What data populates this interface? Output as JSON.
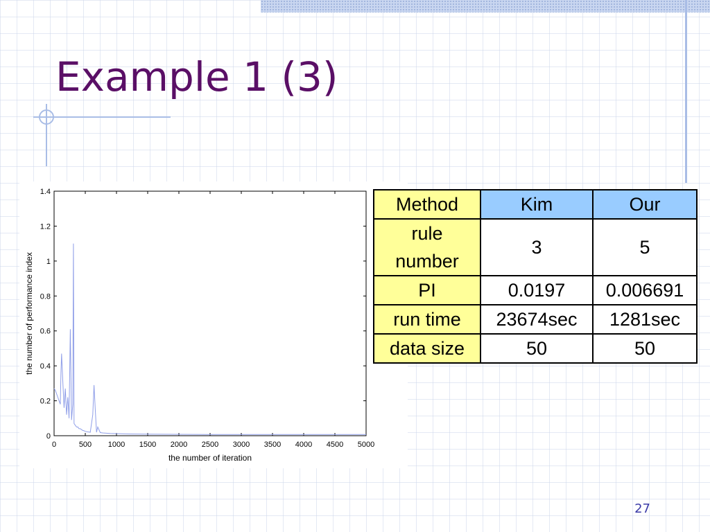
{
  "slide": {
    "title": "Example 1 (3)",
    "page_number": "27",
    "accent_color": "#5a0f66",
    "grid_color": "#cdd7eb"
  },
  "chart_data": {
    "type": "line",
    "title": "",
    "xlabel": "the number of iteration",
    "ylabel": "the number of performance index",
    "xlim": [
      0,
      5000
    ],
    "ylim": [
      0,
      1.4
    ],
    "xticks": [
      0,
      500,
      1000,
      1500,
      2000,
      2500,
      3000,
      3500,
      4000,
      4500,
      5000
    ],
    "yticks": [
      0,
      0.2,
      0.4,
      0.6,
      0.8,
      1,
      1.2,
      1.4
    ],
    "grid": false,
    "line_color": "#8f9ee8",
    "series": [
      {
        "x": [
          0,
          20,
          40,
          60,
          80,
          100,
          110,
          120,
          140,
          160,
          180,
          200,
          220,
          240,
          260,
          280,
          300,
          310,
          320,
          340,
          360,
          380,
          400,
          420,
          440,
          460,
          480,
          500,
          540,
          580,
          620,
          640,
          660,
          680,
          700,
          740,
          780,
          820,
          900,
          1000,
          1200,
          1500,
          2000,
          2500,
          3000,
          3500,
          4000,
          4500,
          5000
        ],
        "y": [
          0.27,
          0.26,
          0.24,
          0.22,
          0.2,
          0.18,
          0.36,
          0.47,
          0.31,
          0.16,
          0.27,
          0.12,
          0.22,
          0.1,
          0.61,
          0.09,
          0.18,
          1.1,
          0.07,
          0.06,
          0.05,
          0.05,
          0.04,
          0.04,
          0.035,
          0.03,
          0.028,
          0.025,
          0.022,
          0.02,
          0.12,
          0.29,
          0.15,
          0.02,
          0.05,
          0.018,
          0.016,
          0.015,
          0.013,
          0.012,
          0.01,
          0.009,
          0.008,
          0.007,
          0.007,
          0.007,
          0.007,
          0.007,
          0.0067
        ]
      }
    ]
  },
  "table": {
    "header": [
      "Method",
      "Kim",
      "Our"
    ],
    "rows": [
      {
        "label_line1": "rule",
        "label_line2": "number",
        "kim": "3",
        "our": "5"
      },
      {
        "label": "PI",
        "kim": "0.0197",
        "our": "0.006691"
      },
      {
        "label": "run time",
        "kim": "23674sec",
        "our": "1281sec"
      },
      {
        "label": "data size",
        "kim": "50",
        "our": "50"
      }
    ]
  }
}
